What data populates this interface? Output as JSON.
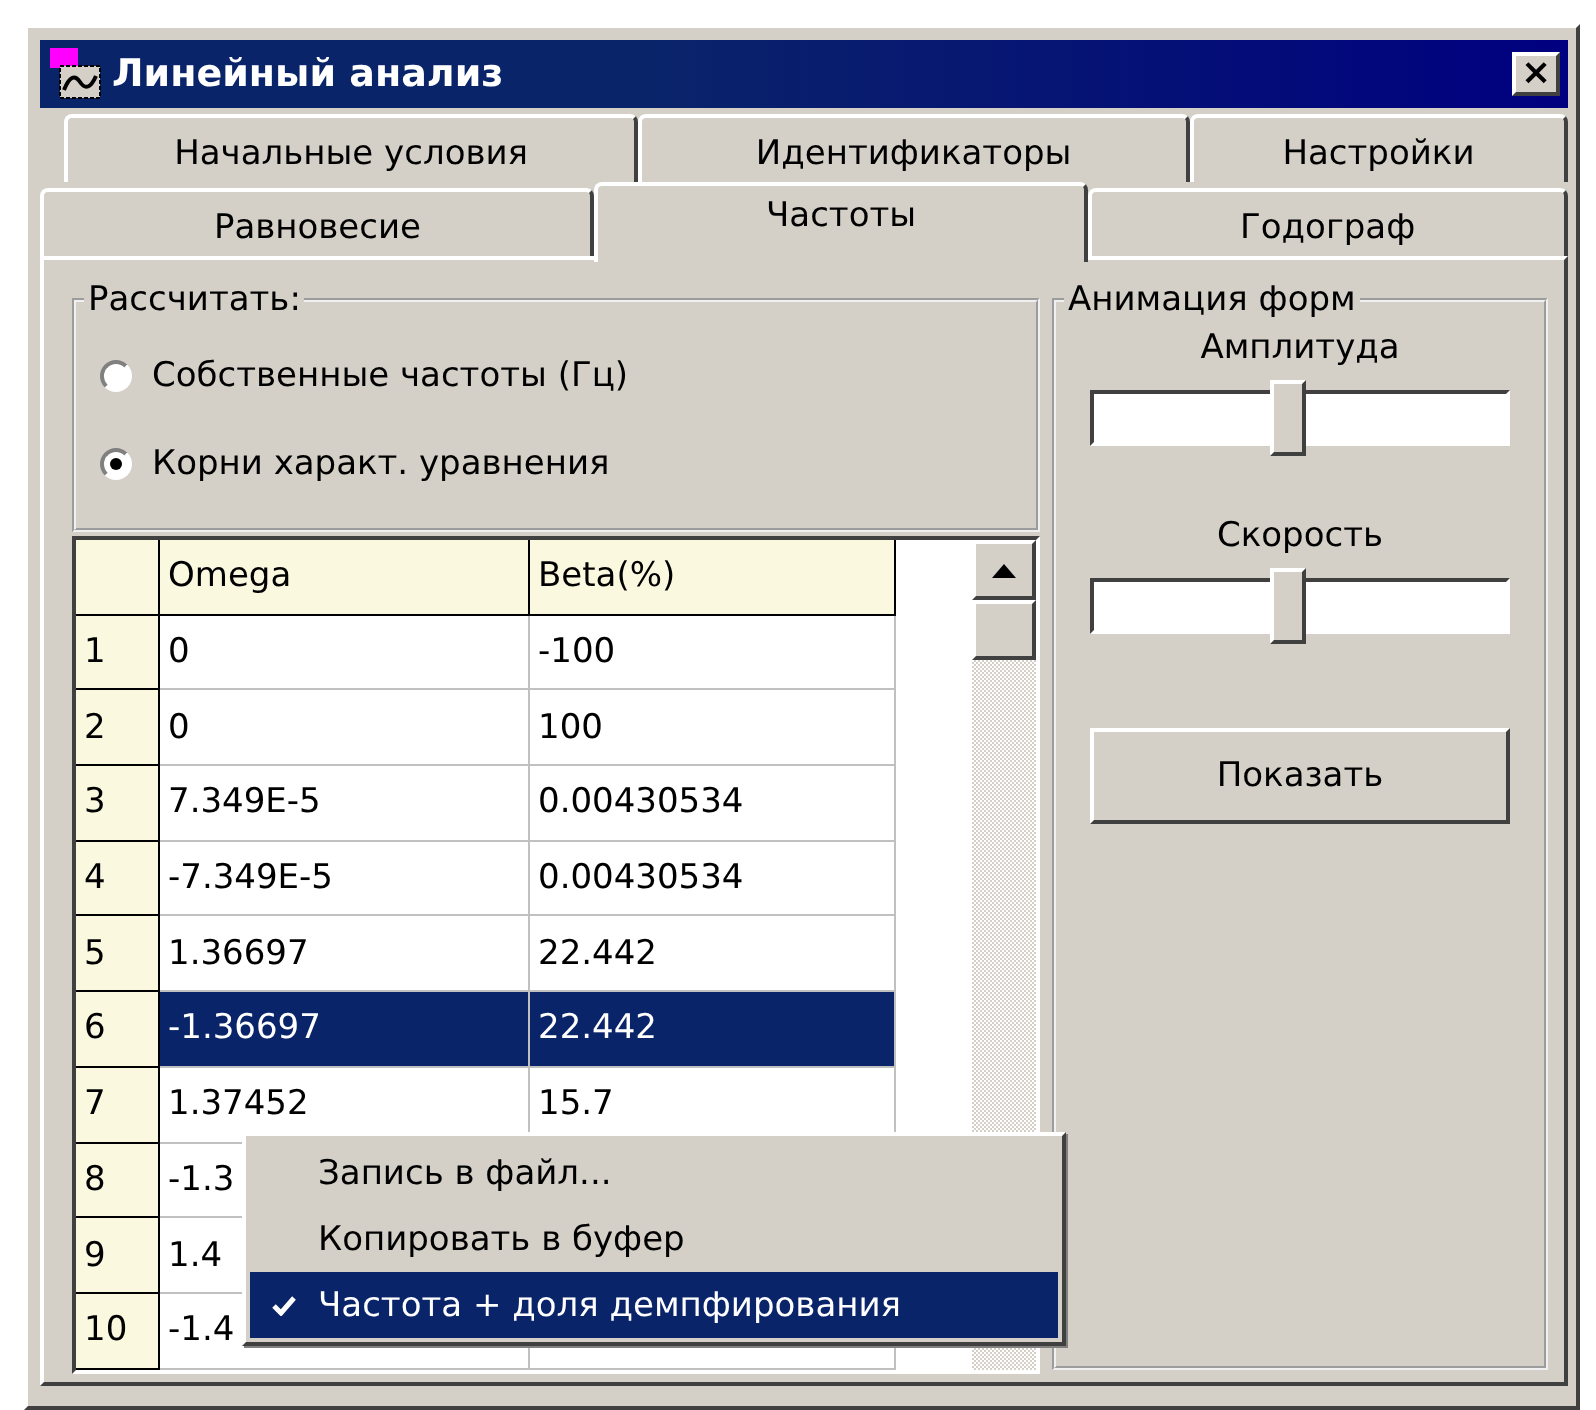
{
  "window": {
    "title": "Линейный анализ",
    "close": "×"
  },
  "tab_rows": [
    [
      {
        "label": "Начальные условия",
        "selected": false
      },
      {
        "label": "Идентификаторы",
        "selected": false
      },
      {
        "label": "Настройки",
        "selected": false
      }
    ],
    [
      {
        "label": "Равновесие",
        "selected": false
      },
      {
        "label": "Частоты",
        "selected": true
      },
      {
        "label": "Годограф",
        "selected": false
      }
    ]
  ],
  "calculate": {
    "title": "Рассчитать:",
    "options": [
      {
        "label": "Собственные частоты (Гц)",
        "selected": false
      },
      {
        "label": "Корни характ. уравнения",
        "selected": true
      }
    ]
  },
  "table": {
    "columns": [
      "Omega",
      "Beta(%)"
    ],
    "rows": [
      {
        "index": "1",
        "cells": [
          "0",
          "-100"
        ],
        "selected": false
      },
      {
        "index": "2",
        "cells": [
          "0",
          "100"
        ],
        "selected": false
      },
      {
        "index": "3",
        "cells": [
          "7.349E-5",
          "0.00430534"
        ],
        "selected": false
      },
      {
        "index": "4",
        "cells": [
          "-7.349E-5",
          "0.00430534"
        ],
        "selected": false
      },
      {
        "index": "5",
        "cells": [
          "1.36697",
          "22.442"
        ],
        "selected": false
      },
      {
        "index": "6",
        "cells": [
          "-1.36697",
          "22.442"
        ],
        "selected": true
      },
      {
        "index": "7",
        "cells": [
          "1.37452",
          "15.7"
        ],
        "selected": false
      },
      {
        "index": "8",
        "cells": [
          "-1.3"
        ],
        "selected": false
      },
      {
        "index": "9",
        "cells": [
          "1.4"
        ],
        "selected": false
      },
      {
        "index": "10",
        "cells": [
          "-1.4"
        ],
        "selected": false
      }
    ]
  },
  "animation": {
    "title": "Анимация форм",
    "sliders": [
      {
        "label": "Амплитуда",
        "level": 0.47
      },
      {
        "label": "Скорость",
        "level": 0.47
      }
    ],
    "button": "Показать"
  },
  "context_menu": [
    {
      "label": "Запись в файл...",
      "checked": false,
      "selected": false
    },
    {
      "label": "Копировать в буфер",
      "checked": false,
      "selected": false
    },
    {
      "label": "Частота + доля демпфирования",
      "checked": true,
      "selected": true
    }
  ]
}
